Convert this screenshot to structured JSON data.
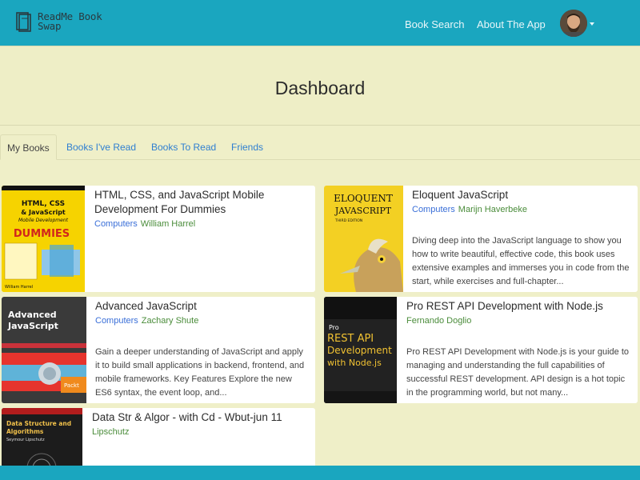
{
  "app": {
    "name_line1": "ReadMe Book",
    "name_line2": "Swap"
  },
  "nav": {
    "book_search": "Book Search",
    "about": "About The App"
  },
  "header": {
    "title": "Dashboard"
  },
  "tabs": [
    {
      "label": "My Books"
    },
    {
      "label": "Books I've Read"
    },
    {
      "label": "Books To Read"
    },
    {
      "label": "Friends"
    }
  ],
  "books": [
    {
      "title_line1": "HTML, CSS, and JavaScript Mobile",
      "title_line2": "Development For Dummies",
      "category": "Computers",
      "author": "William Harrel",
      "description": "",
      "cover": {
        "top": "HTML, CSS",
        "mid": "& JavaScript",
        "sub": "Mobile Development",
        "brand": "DUMMIES",
        "footer": "William Harrel"
      }
    },
    {
      "title_line1": "Eloquent JavaScript",
      "title_line2": "",
      "category": "Computers",
      "author": "Marijn Haverbeke",
      "description": "Diving deep into the JavaScript language to show you how to write beautiful, effective code, this book uses extensive examples and immerses you in code from the start, while exercises and full-chapter...",
      "cover": {
        "top": "ELOQUENT",
        "mid": "JAVASCRIPT",
        "sub": "THIRD EDITION"
      }
    },
    {
      "title_line1": "Advanced JavaScript",
      "title_line2": "",
      "category": "Computers",
      "author": "Zachary Shute",
      "description": "Gain a deeper understanding of JavaScript and apply it to build small applications in backend, frontend, and mobile frameworks. Key Features Explore the new ES6 syntax, the event loop, and...",
      "cover": {
        "top": "Advanced",
        "mid": "JavaScript",
        "brand": "Packt"
      }
    },
    {
      "title_line1": "Pro REST API Development with Node.js",
      "title_line2": "",
      "category": "",
      "author": "Fernando Doglio",
      "description": "Pro REST API Development with Node.js is your guide to managing and understanding the full capabilities of successful REST development. API design is a hot topic in the programming world, but not many...",
      "cover": {
        "top": "Pro",
        "mid": "REST API",
        "sub": "Development",
        "brand": "with Node.js"
      }
    },
    {
      "title_line1": "Data Str & Algor - with Cd - Wbut-jun 11",
      "title_line2": "",
      "category": "",
      "author": "Lipschutz",
      "description": "",
      "cover": {
        "top": "Data Structure and",
        "mid": "Algorithms",
        "sub": "Seymour Lipschutz"
      }
    }
  ],
  "colors": {
    "navbar": "#1aa6bf",
    "page_bg": "#efefc8",
    "link": "#2f7fd1",
    "category": "#3a6fd8",
    "author": "#4a8c3a"
  }
}
